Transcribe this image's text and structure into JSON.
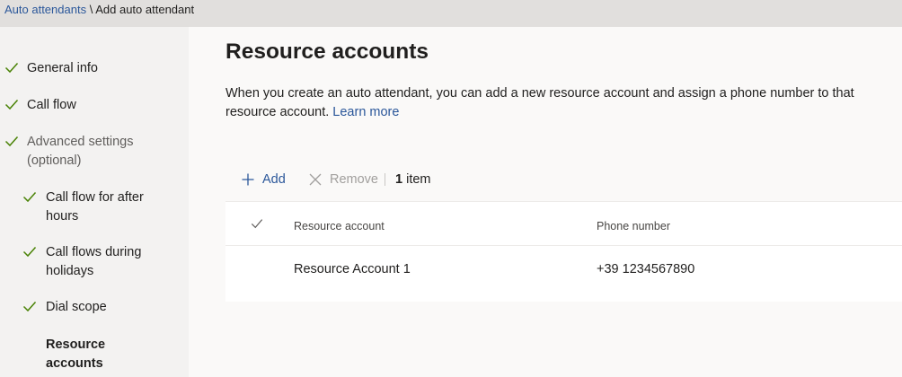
{
  "breadcrumb": {
    "parent": "Auto attendants",
    "separator": "\\",
    "current": "Add auto attendant"
  },
  "sidebar": {
    "steps": [
      {
        "label": "General info",
        "state": "complete",
        "icon": "check-icon"
      },
      {
        "label": "Call flow",
        "state": "complete",
        "icon": "check-icon"
      },
      {
        "label": "Advanced settings (optional)",
        "state": "complete",
        "icon": "check-icon"
      },
      {
        "label": "Call flow for after hours",
        "state": "complete",
        "icon": "check-icon"
      },
      {
        "label": "Call flows during holidays",
        "state": "complete",
        "icon": "check-icon"
      },
      {
        "label": "Dial scope",
        "state": "complete",
        "icon": "check-icon"
      },
      {
        "label": "Resource accounts",
        "state": "current"
      }
    ]
  },
  "main": {
    "title": "Resource accounts",
    "description": "When you create an auto attendant, you can add a new resource account and assign a phone number to that resource account.",
    "learn_more": "Learn more"
  },
  "toolbar": {
    "add_label": "Add",
    "add_icon": "plus-icon",
    "remove_label": "Remove",
    "remove_icon": "close-icon",
    "remove_enabled": false,
    "item_count": "1",
    "item_label": "item"
  },
  "table": {
    "columns": [
      "Resource account",
      "Phone number"
    ],
    "rows": [
      {
        "resource_account": "Resource Account 1",
        "phone_number": "+39 1234567890"
      }
    ]
  },
  "colors": {
    "accent": "#2b579a",
    "check": "#498205",
    "disabled": "#a19f9d",
    "sidebar_background": "#f3f2f1",
    "content_background": "#faf9f8",
    "topbar_background": "#e1dfdd"
  }
}
